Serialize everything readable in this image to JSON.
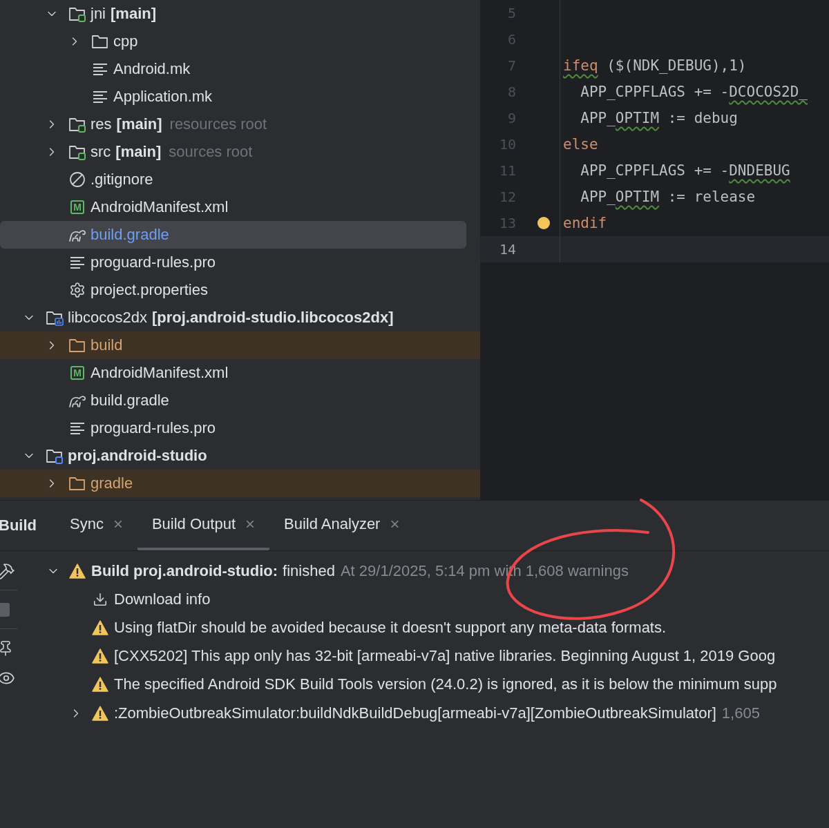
{
  "project_tree": {
    "partial_children": [
      {
        "label": "jni",
        "tag": "[main]",
        "kind": "source-folder",
        "expanded": true,
        "children": [
          {
            "label": "cpp",
            "kind": "folder",
            "expanded": false
          },
          {
            "label": "Android.mk",
            "kind": "text-file"
          },
          {
            "label": "Application.mk",
            "kind": "text-file"
          }
        ]
      },
      {
        "label": "res",
        "tag": "[main]",
        "hint": "resources root",
        "kind": "source-folder",
        "expanded": false
      },
      {
        "label": "src",
        "tag": "[main]",
        "hint": "sources root",
        "kind": "source-folder",
        "expanded": false
      },
      {
        "label": ".gitignore",
        "kind": "ignore-file"
      },
      {
        "label": "AndroidManifest.xml",
        "kind": "manifest",
        "badge": "M"
      },
      {
        "label": "build.gradle",
        "kind": "gradle",
        "selected": true,
        "color": "#6f9ff0"
      },
      {
        "label": "proguard-rules.pro",
        "kind": "text-file",
        "selected": false
      },
      {
        "label": "project.properties",
        "kind": "properties"
      }
    ],
    "items": [
      {
        "label": "libcocos2dx",
        "tag": "[proj.android-studio.libcocos2dx]",
        "kind": "module",
        "expanded": true,
        "children": [
          {
            "label": "build",
            "kind": "folder",
            "expanded": false,
            "excluded": true
          },
          {
            "label": "AndroidManifest.xml",
            "kind": "manifest",
            "badge": "M"
          },
          {
            "label": "build.gradle",
            "kind": "gradle"
          },
          {
            "label": "proguard-rules.pro",
            "kind": "text-file"
          }
        ]
      },
      {
        "label": "proj.android-studio",
        "kind": "project",
        "bold": true,
        "expanded": true,
        "children": [
          {
            "label": "gradle",
            "kind": "folder",
            "expanded": false,
            "excluded": true
          }
        ]
      }
    ]
  },
  "editor": {
    "lines": [
      {
        "number": "5"
      },
      {
        "number": "6"
      },
      {
        "number": "7",
        "tokens": [
          {
            "text": "ifeq",
            "kind": "keyword-warn"
          },
          {
            "text": " ($(NDK_DEBUG),1)",
            "kind": "plain"
          }
        ]
      },
      {
        "number": "8",
        "tokens": [
          {
            "text": "  APP_CPPFLAGS += -",
            "kind": "plain"
          },
          {
            "text": "DCOCOS2D_",
            "kind": "warn"
          }
        ]
      },
      {
        "number": "9",
        "tokens": [
          {
            "text": "  APP_",
            "kind": "plain"
          },
          {
            "text": "OPTIM",
            "kind": "warn"
          },
          {
            "text": " := debug",
            "kind": "plain"
          }
        ]
      },
      {
        "number": "10",
        "tokens": [
          {
            "text": "else",
            "kind": "keyword"
          }
        ]
      },
      {
        "number": "11",
        "tokens": [
          {
            "text": "  APP_CPPFLAGS += -",
            "kind": "plain"
          },
          {
            "text": "DNDEBUG",
            "kind": "warn"
          }
        ]
      },
      {
        "number": "12",
        "tokens": [
          {
            "text": "  APP_",
            "kind": "plain"
          },
          {
            "text": "OPTIM",
            "kind": "warn"
          },
          {
            "text": " := release",
            "kind": "plain"
          }
        ]
      },
      {
        "number": "13",
        "tokens": [
          {
            "text": "endif",
            "kind": "keyword"
          }
        ],
        "intention_bulb": true
      },
      {
        "number": "14",
        "current": true
      }
    ]
  },
  "build_panel": {
    "title": "Build",
    "tabs": [
      {
        "label": "Sync",
        "selected": false,
        "close": "×"
      },
      {
        "label": "Build Output",
        "selected": true,
        "close": "×"
      },
      {
        "label": "Build Analyzer",
        "selected": false,
        "close": "×"
      }
    ],
    "output": [
      {
        "kind": "warning",
        "expanded": true,
        "title": "Build proj.android-studio:",
        "text": "finished",
        "detail": "At 29/1/2025, 5:14 pm with 1,608 warnings",
        "children": [
          {
            "kind": "download",
            "text": "Download info"
          },
          {
            "kind": "warning",
            "text": "Using flatDir should be avoided because it doesn't support any meta-data formats."
          },
          {
            "kind": "warning",
            "text": "[CXX5202] This app only has 32-bit [armeabi-v7a] native libraries. Beginning August 1, 2019 Goog"
          },
          {
            "kind": "warning",
            "text": "The specified Android SDK Build Tools version (24.0.2) is ignored, as it is below the minimum supp"
          },
          {
            "kind": "warning",
            "expanded": false,
            "text": ":ZombieOutbreakSimulator:buildNdkBuildDebug[armeabi-v7a][ZombieOutbreakSimulator]",
            "detail": "1,605"
          }
        ]
      }
    ]
  }
}
